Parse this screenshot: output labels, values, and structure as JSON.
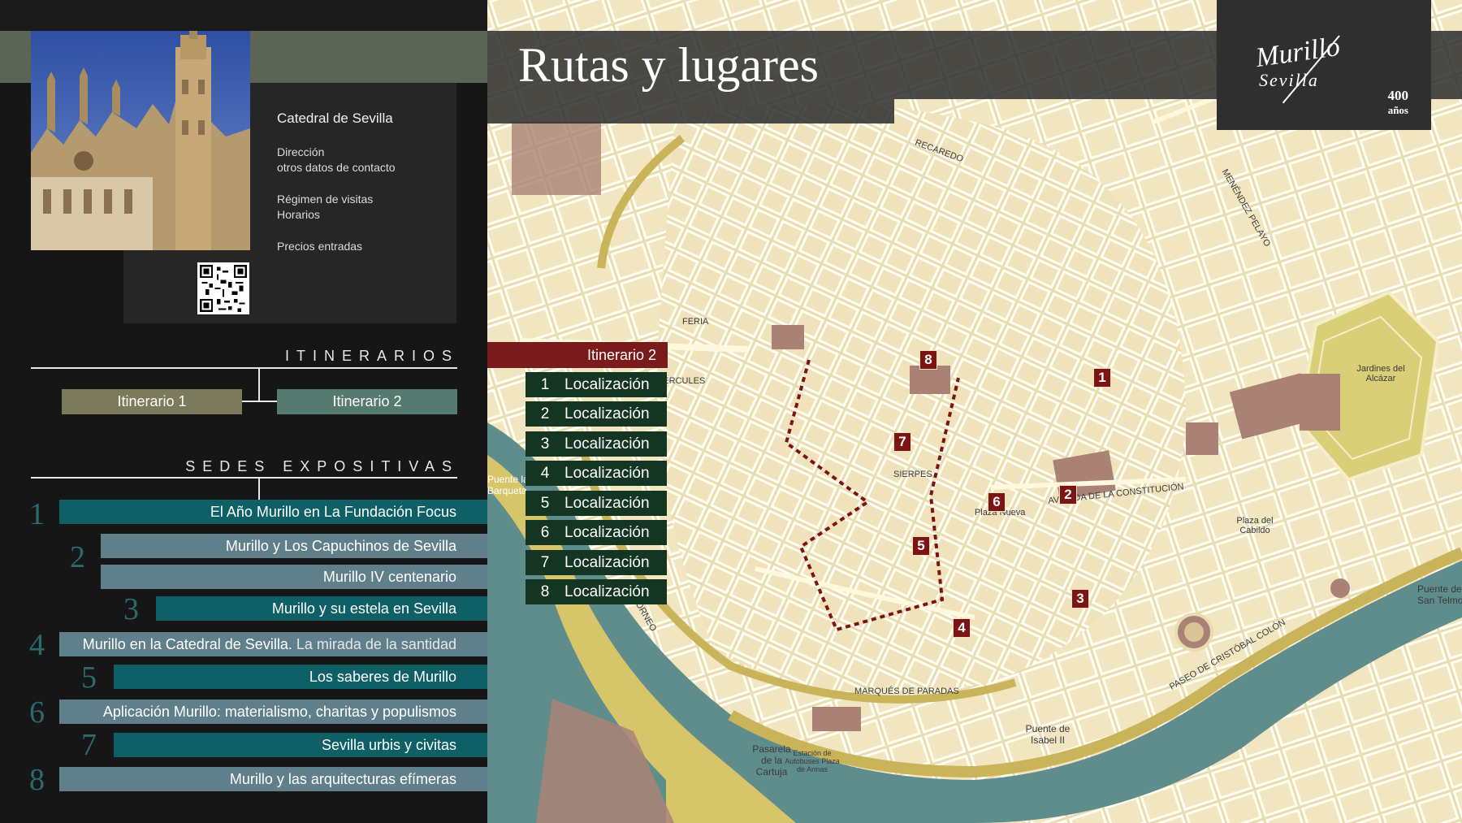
{
  "header": {
    "title": "Rutas y lugares",
    "logo": {
      "signature": "Murillo",
      "city": "Sevilla",
      "number": "400",
      "unit": "años"
    }
  },
  "info": {
    "title": "Catedral de Sevilla",
    "lines": [
      "Dirección",
      "otros datos de contacto",
      "Régimen de visitas",
      "Horarios",
      "Precios entradas"
    ]
  },
  "itinerarios": {
    "header": "ITINERARIOS",
    "items": [
      "Itinerario 1",
      "Itinerario 2"
    ]
  },
  "sedes": {
    "header": "SEDES EXPOSITIVAS",
    "items": [
      {
        "num": "1",
        "label": "El Año Murillo en La Fundación Focus"
      },
      {
        "num": "2",
        "label": "Murillo y Los Capuchinos de Sevilla"
      },
      {
        "num": "",
        "label": "Murillo IV centenario"
      },
      {
        "num": "3",
        "label": "Murillo y su estela en Sevilla"
      },
      {
        "num": "4",
        "label": "Murillo en la Catedral de Sevilla.",
        "label_extra": "La mirada de la santidad"
      },
      {
        "num": "5",
        "label": "Los saberes de Murillo"
      },
      {
        "num": "6",
        "label": "Aplicación Murillo: materialismo, charitas y populismos"
      },
      {
        "num": "7",
        "label": "Sevilla urbis y civitas"
      },
      {
        "num": "8",
        "label": "Murillo y las arquitecturas efímeras"
      }
    ]
  },
  "map_panel": {
    "active_itinerary": "Itinerario 2",
    "locations": [
      {
        "num": "1",
        "label": "Localización"
      },
      {
        "num": "2",
        "label": "Localización"
      },
      {
        "num": "3",
        "label": "Localización"
      },
      {
        "num": "4",
        "label": "Localización"
      },
      {
        "num": "5",
        "label": "Localización"
      },
      {
        "num": "6",
        "label": "Localización"
      },
      {
        "num": "7",
        "label": "Localización"
      },
      {
        "num": "8",
        "label": "Localización"
      }
    ],
    "markers": [
      "1",
      "2",
      "3",
      "4",
      "5",
      "6",
      "7",
      "8"
    ]
  },
  "map_labels": {
    "alameda": "ALAMEDA DE HÉRCULES",
    "pasarela": "Pasarela de la Cartuja",
    "puente_barqueta": "Puente la Barqueta",
    "puente_isabel": "Puente de Isabel II",
    "puente_telmo": "Puente de San Telmo",
    "constitucion": "AVENIDA DE LA CONSTITUCIÓN",
    "colon": "PASEO DE CRISTÓBAL COLÓN",
    "marques": "MARQUÉS DE PARADAS",
    "torneo": "TORNEO",
    "feria": "FERIA",
    "sierpes": "SIERPES",
    "plaza_nueva": "Plaza Nueva",
    "estacion": "Estación de Autobuses Plaza de Armas",
    "jardines": "Jardines del Alcázar",
    "plaza_cabildo": "Plaza del Cabildo",
    "recaredo": "RECAREDO",
    "menendez": "MENÉNDEZ PELAYO"
  },
  "colors": {
    "accent_teal": "#0f5f66",
    "accent_slate": "#5f808a",
    "itinerary_red": "#7d1414",
    "location_green": "#143522",
    "map_base": "#e9dcb0",
    "river": "#5f8d8c"
  }
}
